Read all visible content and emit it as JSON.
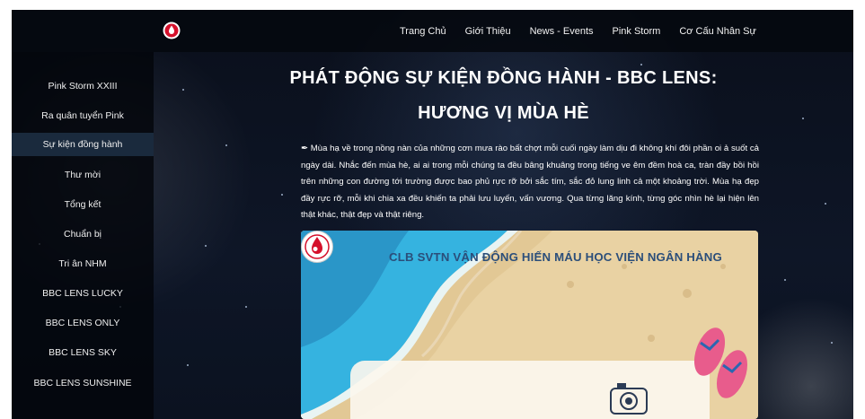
{
  "nav": {
    "items": [
      "Trang Chủ",
      "Giới Thiệu",
      "News - Events",
      "Pink Storm",
      "Cơ Cấu Nhân Sự"
    ]
  },
  "sidebar": {
    "items": [
      {
        "label": "Pink Storm XXIII"
      },
      {
        "label": "Ra quân tuyển Pink"
      },
      {
        "label": "Sự kiện đồng hành"
      },
      {
        "label": "Thư mời"
      },
      {
        "label": "Tổng kết"
      },
      {
        "label": "Chuẩn bị"
      },
      {
        "label": "Tri ân NHM"
      },
      {
        "label": "BBC LENS LUCKY"
      },
      {
        "label": "BBC LENS ONLY"
      },
      {
        "label": "BBC LENS SKY"
      },
      {
        "label": "BBC LENS SUNSHINE"
      }
    ],
    "active_label": "Sự kiện đồng hành"
  },
  "article": {
    "title_line1": "PHÁT ĐỘNG SỰ KIỆN ĐỒNG HÀNH - BBC LENS:",
    "title_line2": "HƯƠNG VỊ MÙA HÈ",
    "paragraph": "✒ Mùa hạ về trong nồng nàn của những cơn mưa rào bất chợt mỗi cuối ngày làm dịu đi không khí đôi phần oi ả suốt cả ngày dài. Nhắc đến mùa hè, ai ai trong mỗi chúng ta đều bâng khuâng trong tiếng ve êm đềm hoà ca, tràn đầy bồi hồi trên những con đường tới trường được bao phủ rực rỡ bởi sắc tím, sắc đỏ lung linh cả một khoảng trời. Mùa hạ đẹp đầy rực rỡ, mỗi khi chia xa đều khiến ta phải lưu luyến, vấn vương. Qua từng lăng kính, từng góc nhìn hè lại hiện lên thật khác, thật đẹp và thật riêng."
  },
  "banner": {
    "club_name": "CLB SVTN VẬN ĐỘNG HIẾN MÁU HỌC VIỆN NGÂN HÀNG"
  },
  "colors": {
    "background": "#0b1220",
    "sidebar_active": "#1a2a3d",
    "club_name": "#2b4e7a",
    "sand": "#e8cf9e",
    "sea": "#35b3e0",
    "logo_red": "#d5102b"
  },
  "icons": [
    "blood-drop-logo-icon",
    "club-logo-icon",
    "camera-icon",
    "flip-flops-icon"
  ]
}
